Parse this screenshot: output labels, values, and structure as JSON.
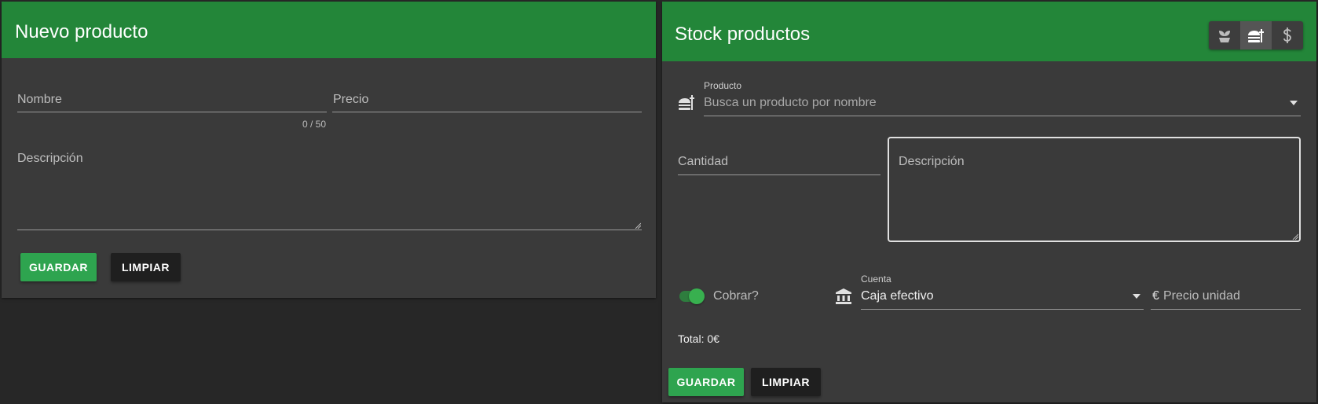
{
  "new_product": {
    "title": "Nuevo producto",
    "name_label": "Nombre",
    "name_counter": "0 / 50",
    "price_label": "Precio",
    "description_label": "Descripción",
    "save_label": "GUARDAR",
    "clear_label": "LIMPIAR"
  },
  "stock": {
    "title": "Stock productos",
    "toolbar_icons": [
      "seedling-icon",
      "food-icon",
      "dollar-icon"
    ],
    "product_label": "Producto",
    "product_placeholder": "Busca un producto por nombre",
    "quantity_label": "Cantidad",
    "description_label": "Descripción",
    "charge_label": "Cobrar?",
    "charge_enabled": true,
    "account_label": "Cuenta",
    "account_value": "Caja efectivo",
    "currency_symbol": "€",
    "unit_price_label": "Precio unidad",
    "total_text": "Total: 0€",
    "save_label": "GUARDAR",
    "clear_label": "LIMPIAR"
  },
  "colors": {
    "header_green": "#238639",
    "primary_button": "#2ea44f",
    "dark_button": "#1f1f1f",
    "card_bg": "#3a3a3a",
    "page_bg": "#272727"
  }
}
